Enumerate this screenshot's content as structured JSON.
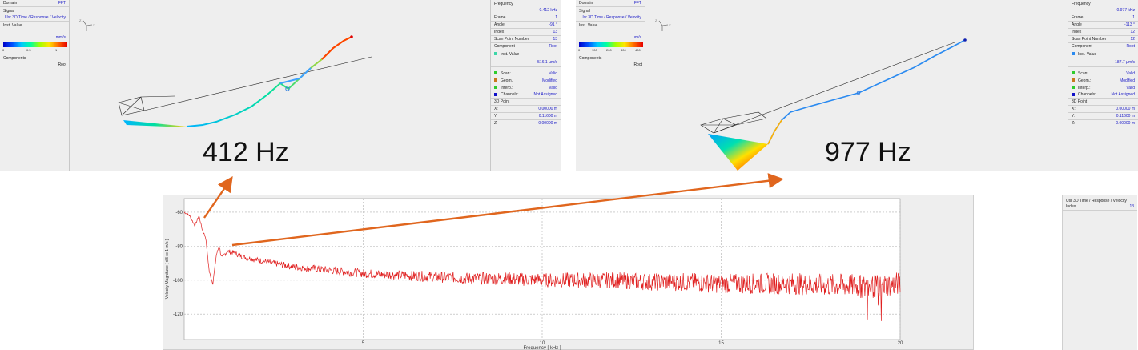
{
  "left_panel": {
    "domain_label": "Domain",
    "domain_value": "FFT",
    "signal_label": "Signal",
    "signal_value": "Usr 3D Time / Response / Velocity",
    "inst_label": "Inst. Value",
    "unit": "mm/s",
    "ticks": [
      "0",
      "0.5",
      "1"
    ],
    "components_label": "Components",
    "components_value": "Root"
  },
  "right_panel_a": {
    "rows": [
      {
        "label": "Frequency",
        "value": ""
      },
      {
        "label": "",
        "value": "0.412 kHz"
      },
      {
        "label": "Frame",
        "value": "1"
      },
      {
        "label": "Angle",
        "value": "-91 °"
      },
      {
        "label": "Index",
        "value": "13"
      },
      {
        "label": "Scan Point Number",
        "value": "13"
      },
      {
        "label": "Component",
        "value": "Root"
      }
    ],
    "inst_label": "Inst. Value",
    "inst_value": "516.1 µm/s",
    "status": [
      {
        "label": "Scan:",
        "value": "Valid",
        "color": "#2ecc2e"
      },
      {
        "label": "Geom.:",
        "value": "Modified",
        "color": "#c8781e"
      },
      {
        "label": "Interp.:",
        "value": "Valid",
        "color": "#2ecc2e"
      },
      {
        "label": "Channels:",
        "value": "Not Assigned",
        "color": "#1010c8"
      }
    ],
    "point_label": "3D Point",
    "coords": [
      {
        "label": "X:",
        "value": "0.00000 m"
      },
      {
        "label": "Y:",
        "value": "0.11600 m"
      },
      {
        "label": "Z:",
        "value": "0.00000 m"
      }
    ]
  },
  "left_panel_b": {
    "domain_label": "Domain",
    "domain_value": "FFT",
    "signal_label": "Signal",
    "signal_value": "Usr 3D Time / Response / Velocity",
    "inst_label": "Inst. Value",
    "unit": "µm/s",
    "ticks": [
      "0",
      "100",
      "200",
      "300",
      "400"
    ],
    "components_label": "Components",
    "components_value": "Root"
  },
  "right_panel_b": {
    "rows": [
      {
        "label": "Frequency",
        "value": ""
      },
      {
        "label": "",
        "value": "0.977 kHz"
      },
      {
        "label": "Frame",
        "value": "1"
      },
      {
        "label": "Angle",
        "value": "-113 °"
      },
      {
        "label": "Index",
        "value": "12"
      },
      {
        "label": "Scan Point Number",
        "value": "12"
      },
      {
        "label": "Component",
        "value": "Root"
      }
    ],
    "inst_label": "Inst. Value",
    "inst_value": "187.7 µm/s",
    "status": [
      {
        "label": "Scan:",
        "value": "Valid",
        "color": "#2ecc2e"
      },
      {
        "label": "Geom.:",
        "value": "Modified",
        "color": "#c8781e"
      },
      {
        "label": "Interp.:",
        "value": "Valid",
        "color": "#2ecc2e"
      },
      {
        "label": "Channels:",
        "value": "Not Assigned",
        "color": "#1010c8"
      }
    ],
    "point_label": "3D Point",
    "coords": [
      {
        "label": "X:",
        "value": "0.00000 m"
      },
      {
        "label": "Y:",
        "value": "0.11600 m"
      },
      {
        "label": "Z:",
        "value": "0.00000 m"
      }
    ]
  },
  "annotations": {
    "freq_a": "412 Hz",
    "freq_b": "977 Hz",
    "arrow_color": "#e0661e"
  },
  "legend": {
    "title": "Usr 3D Time / Response / Velocity",
    "index_label": "Index",
    "index_value": "13"
  },
  "chart_data": {
    "type": "line",
    "xlabel": "Frequency [ kHz ]",
    "ylabel": "Velocity Magnitude [ dB re 1 m/s ]",
    "xlim": [
      0,
      20
    ],
    "ylim": [
      -135,
      -52
    ],
    "xticks": [
      5,
      10,
      15,
      20
    ],
    "yticks": [
      -60,
      -80,
      -100,
      -120
    ],
    "grid": true,
    "line_color": "#e02020",
    "series": [
      {
        "values_kind": "envelope",
        "x": [
          0.0,
          0.15,
          0.3,
          0.412,
          0.5,
          0.6,
          0.7,
          0.8,
          0.9,
          0.977,
          1.05,
          1.2,
          1.4,
          1.6,
          1.8,
          2.0,
          2.5,
          3,
          4,
          5,
          6,
          7,
          8,
          9,
          10,
          11,
          12,
          13,
          14,
          15,
          16,
          17,
          18,
          18.5,
          19,
          19.2,
          19.5,
          20
        ],
        "y": [
          -60,
          -62,
          -68,
          -62,
          -70,
          -75,
          -95,
          -102,
          -85,
          -80,
          -87,
          -83,
          -84,
          -86,
          -87,
          -88,
          -90,
          -92,
          -94,
          -96,
          -97,
          -98,
          -99,
          -99,
          -100,
          -100,
          -100,
          -101,
          -101,
          -102,
          -102,
          -102,
          -103,
          -103,
          -104,
          -104,
          -103,
          -102
        ]
      }
    ]
  }
}
